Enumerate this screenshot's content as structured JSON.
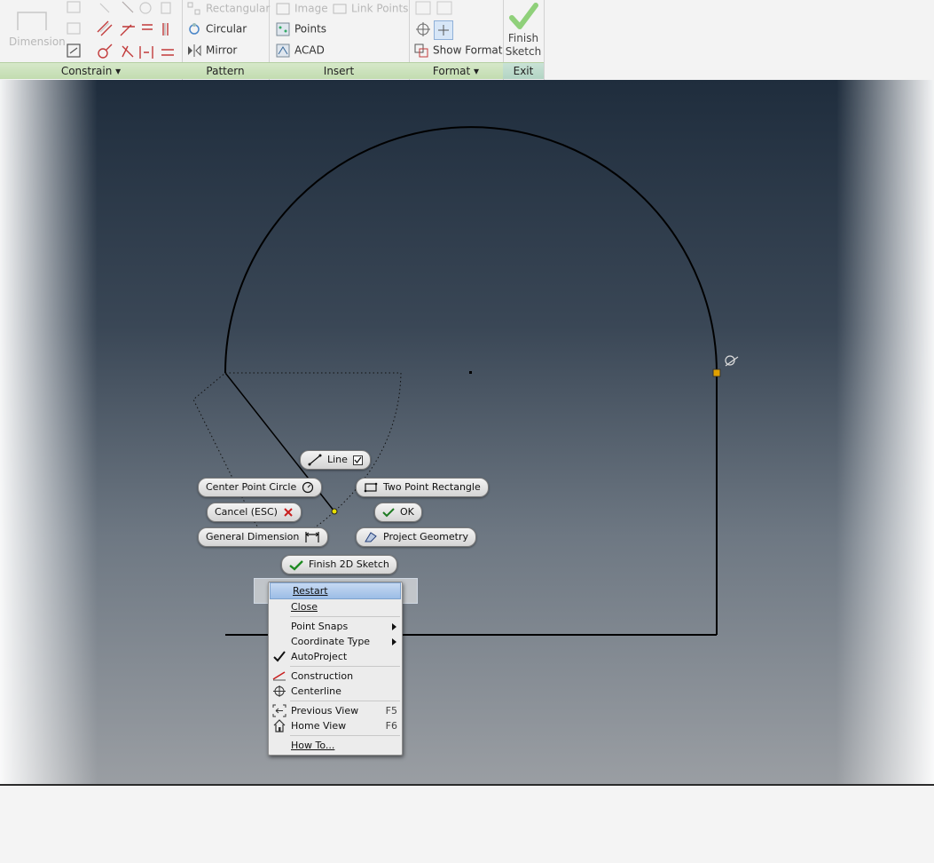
{
  "ribbon": {
    "dimension_label": "Dimension",
    "panels": {
      "constrain": "Constrain",
      "pattern": "Pattern",
      "insert": "Insert",
      "format": "Format",
      "exit": "Exit"
    },
    "pattern_items": [
      "Rectangular",
      "Circular",
      "Mirror"
    ],
    "insert_items": [
      "Image",
      "Link Points",
      "Points",
      "ACAD"
    ],
    "format_items": [
      "Show Format"
    ],
    "finish_sketch": [
      "Finish",
      "Sketch"
    ]
  },
  "marking_menu": {
    "line": "Line",
    "center_point_circle": "Center Point Circle",
    "two_point_rectangle": "Two Point Rectangle",
    "cancel": "Cancel (ESC)",
    "ok": "OK",
    "general_dimension": "General Dimension",
    "project_geometry": "Project Geometry",
    "finish_2d_sketch": "Finish 2D Sketch"
  },
  "context_menu": {
    "restart": "Restart",
    "close": "Close",
    "point_snaps": "Point Snaps",
    "coordinate_type": "Coordinate Type",
    "autoproject": "AutoProject",
    "construction": "Construction",
    "centerline": "Centerline",
    "previous_view": "Previous View",
    "previous_view_key": "F5",
    "home_view": "Home View",
    "home_view_key": "F6",
    "how_to": "How To..."
  },
  "colors": {
    "panel_title_bg": "#c2dcb0",
    "canvas_top": "#1f2d3d",
    "canvas_bottom": "#9a9ea3",
    "endpoint_marker": "#e0a000",
    "highlight": "#9cbde6"
  }
}
